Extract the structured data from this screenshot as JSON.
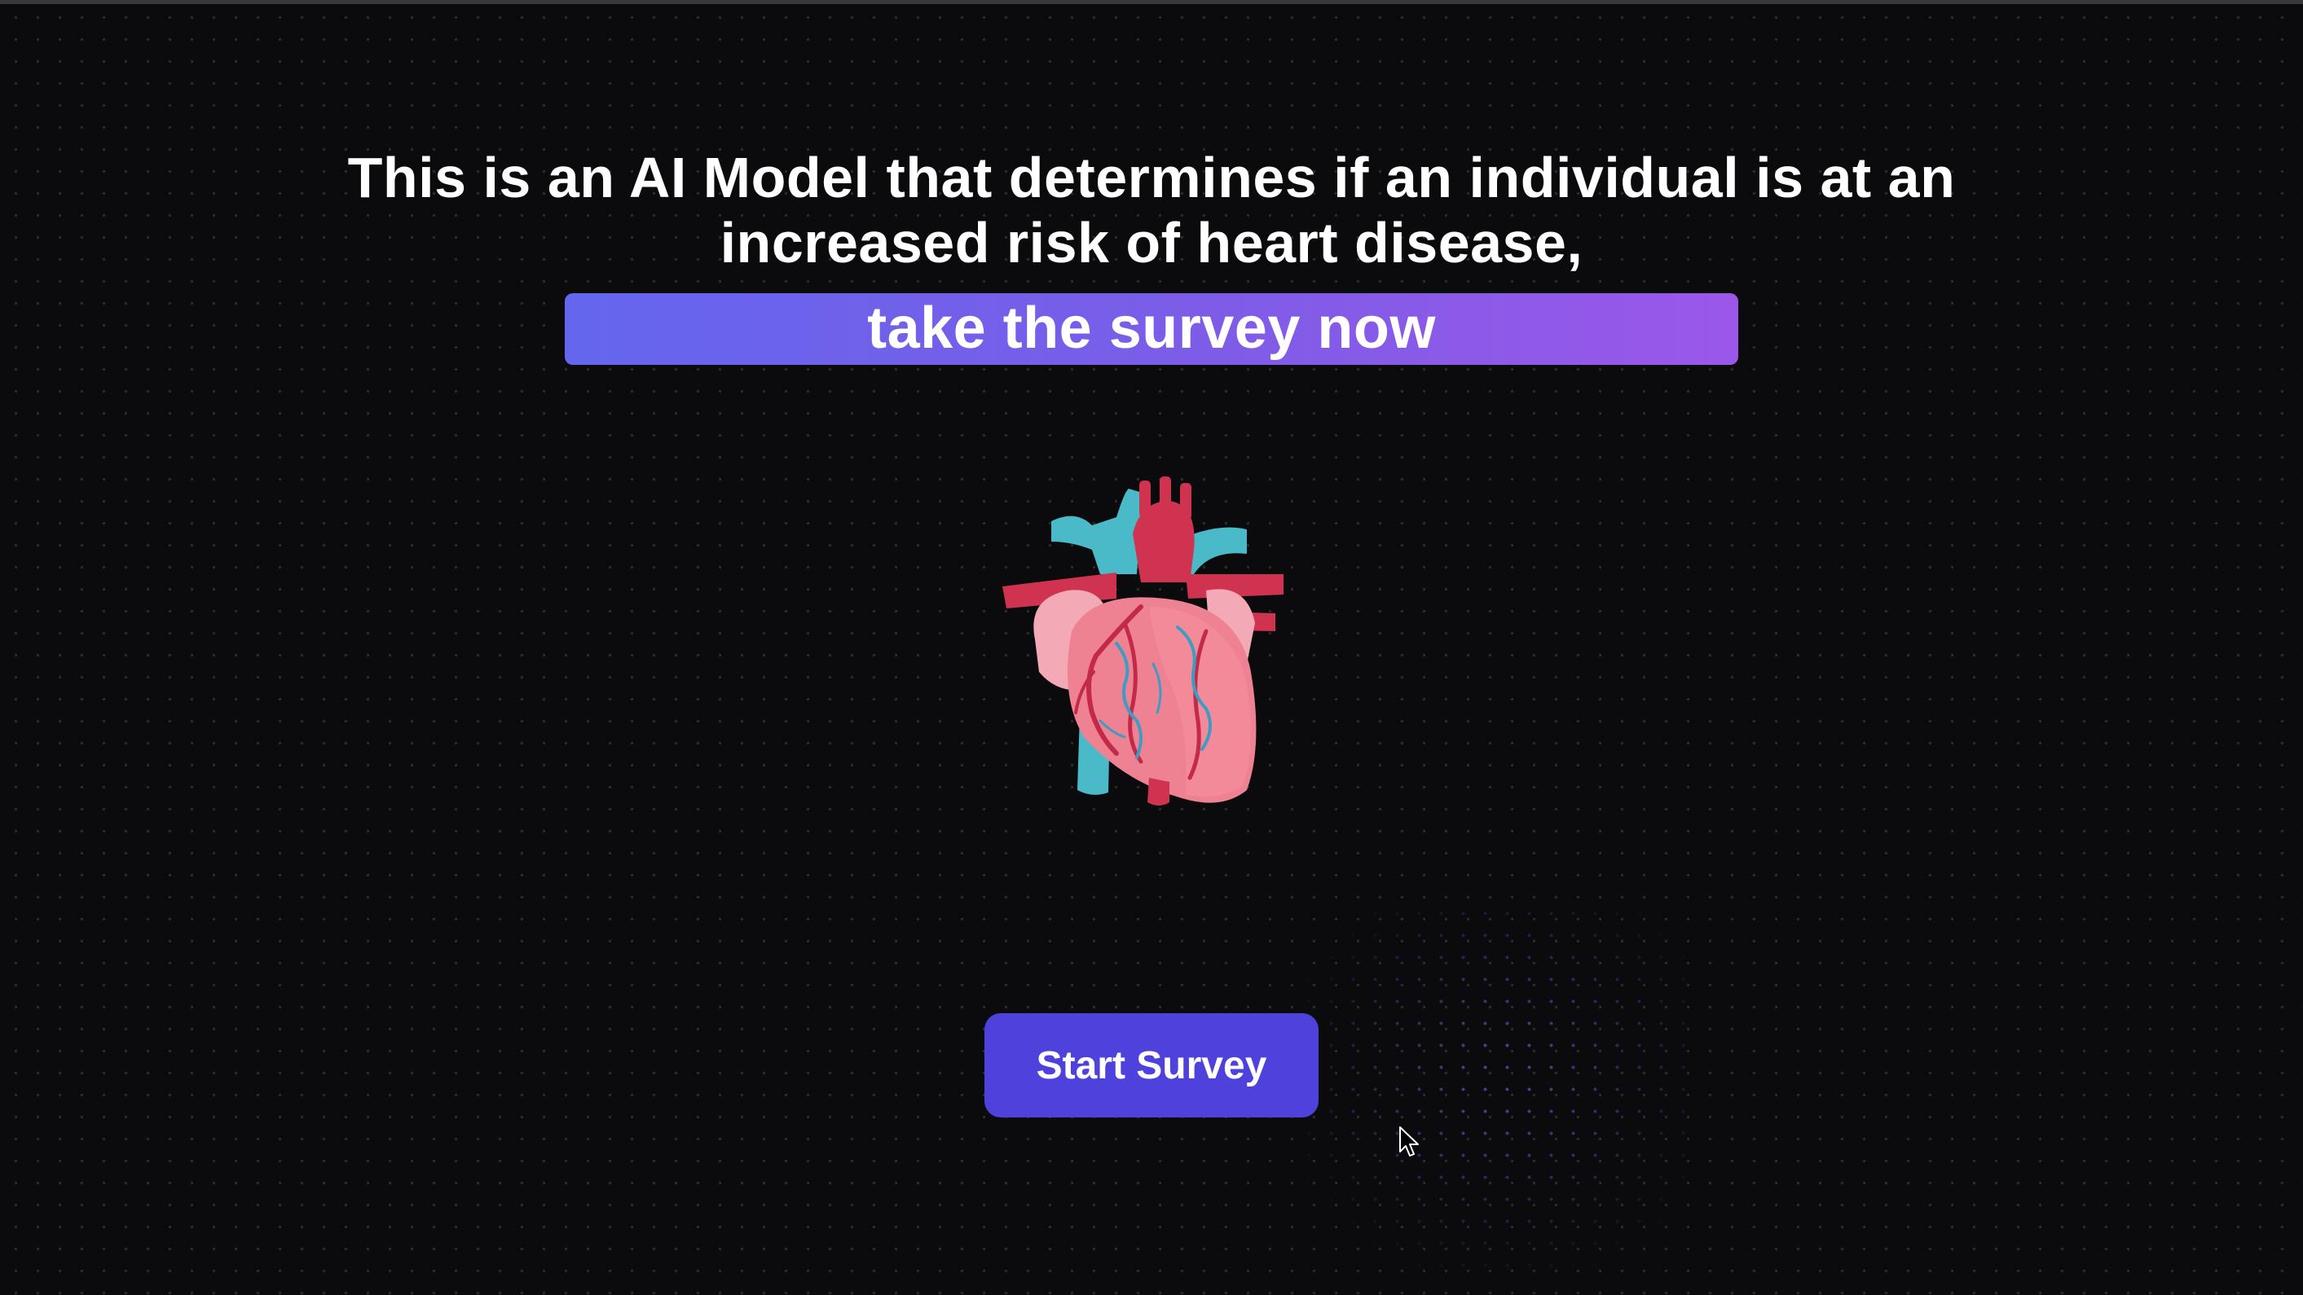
{
  "hero": {
    "headline": "This is an AI Model that determines if an individual is at an increased risk of heart disease,",
    "cta_banner": "take the survey now",
    "image_icon": "anatomical-heart-icon"
  },
  "actions": {
    "start_button": "Start Survey"
  },
  "colors": {
    "background": "#0b0b0e",
    "banner_gradient_start": "#6466ee",
    "banner_gradient_end": "#9b57e9",
    "button": "#4e41dc",
    "text": "#ffffff"
  }
}
